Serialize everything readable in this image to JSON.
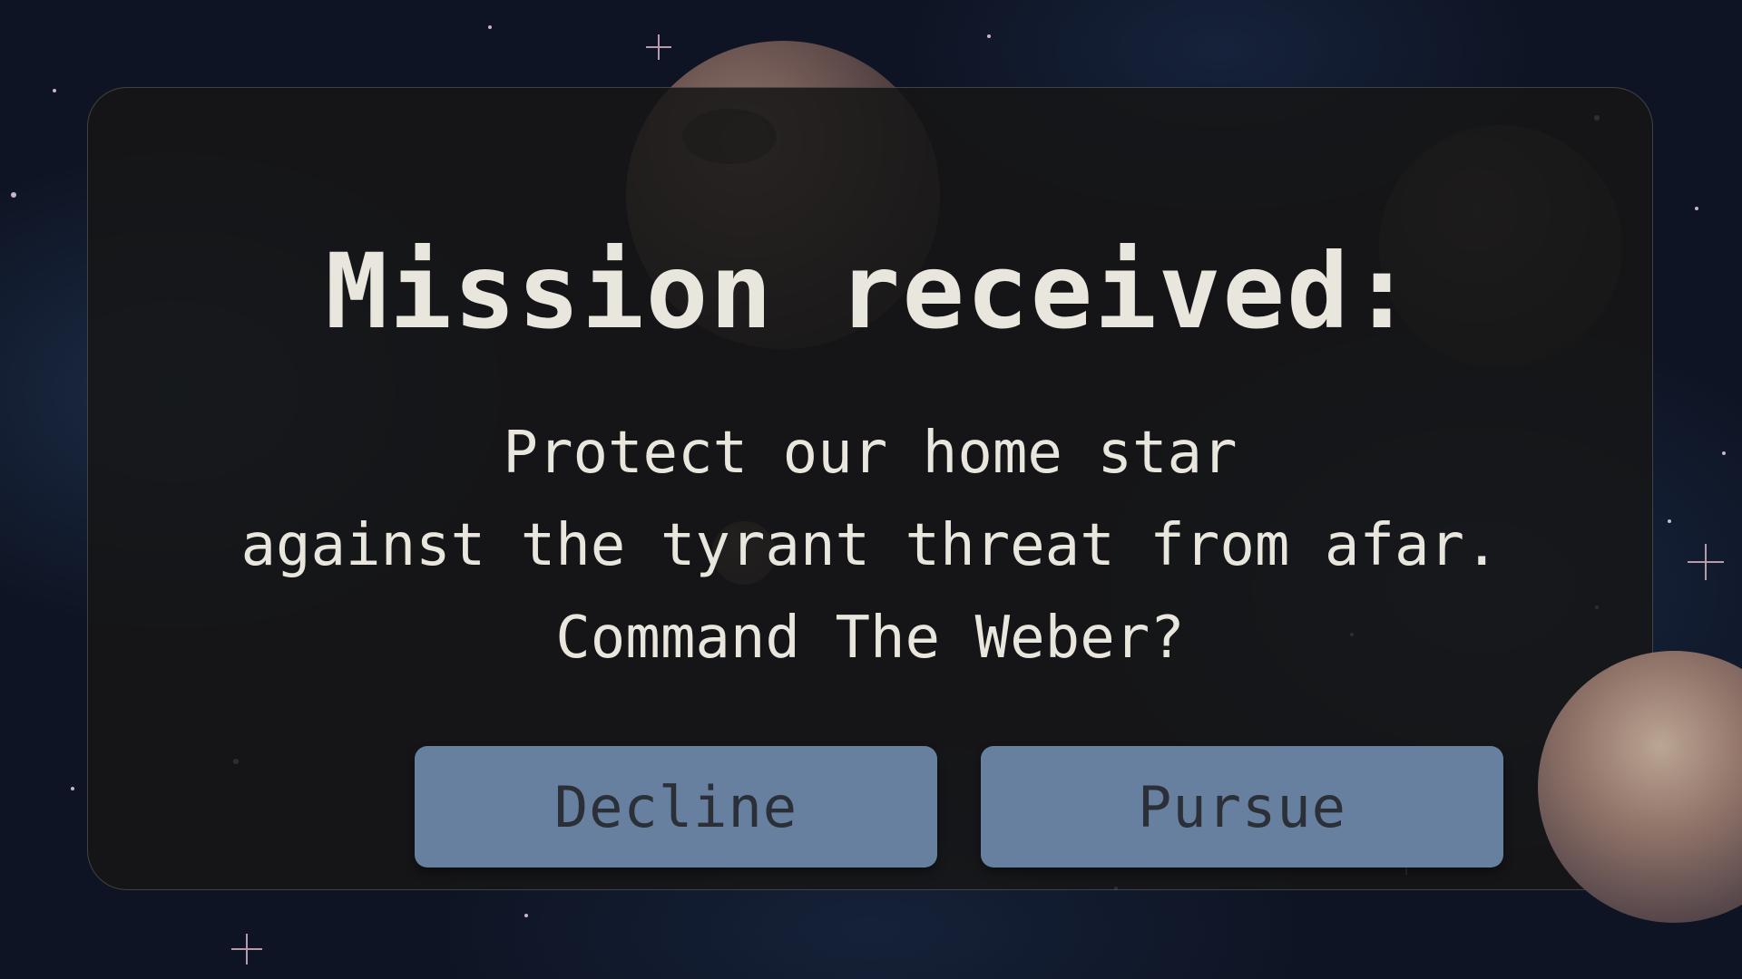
{
  "dialog": {
    "title": "Mission received:",
    "body_lines": [
      "Protect our home star",
      "against the tyrant threat from afar.",
      "Command The Weber?"
    ],
    "buttons": {
      "decline_label": "Decline",
      "pursue_label": "Pursue"
    }
  },
  "colors": {
    "background": "#0e1423",
    "panel": "#161616",
    "text": "#e8e6dd",
    "button": "#6880a0",
    "button_text": "#2a2f38"
  }
}
